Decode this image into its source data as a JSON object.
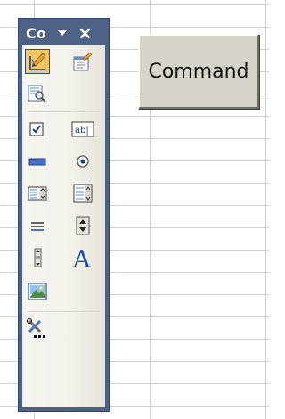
{
  "sheet": {
    "command_button_label": "Command"
  },
  "toolbox": {
    "title": "Control Toolbox",
    "title_visible": "Co",
    "dropdown_glyph": "▼",
    "close_glyph": "✕",
    "tools": [
      {
        "name": "design-mode",
        "icon": "design-mode-icon",
        "active": true
      },
      {
        "name": "properties",
        "icon": "properties-icon",
        "active": false
      },
      {
        "name": "view-code",
        "icon": "view-code-icon",
        "active": false
      },
      {
        "name": "check-box",
        "icon": "checkbox-icon",
        "active": false
      },
      {
        "name": "text-box",
        "icon": "textbox-icon",
        "active": false
      },
      {
        "name": "command-button",
        "icon": "command-button-icon",
        "active": false
      },
      {
        "name": "option-button",
        "icon": "option-button-icon",
        "active": false
      },
      {
        "name": "list-box",
        "icon": "listbox-icon",
        "active": false
      },
      {
        "name": "combo-box",
        "icon": "combobox-icon",
        "active": false
      },
      {
        "name": "toggle-button",
        "icon": "toggle-button-icon",
        "active": false
      },
      {
        "name": "spin-button",
        "icon": "spin-button-icon",
        "active": false
      },
      {
        "name": "scroll-bar",
        "icon": "scrollbar-icon",
        "active": false
      },
      {
        "name": "label",
        "icon": "label-icon",
        "active": false
      },
      {
        "name": "image",
        "icon": "image-icon",
        "active": false
      },
      {
        "name": "more-controls",
        "icon": "more-controls-icon",
        "active": false
      }
    ],
    "label_tool_glyph": "A",
    "textbox_tool_text": "ab|"
  },
  "colors": {
    "titlebar": "#4d6185",
    "active_tool": "#f7c765",
    "button_face": "#d8d4cb"
  }
}
